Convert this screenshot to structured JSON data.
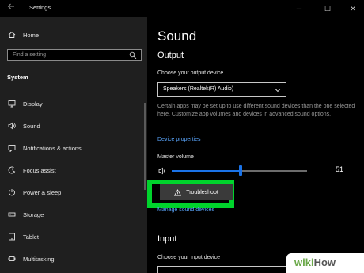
{
  "window": {
    "title": "Settings",
    "controls": {
      "minimize": "─",
      "maximize": "☐",
      "close": "✕"
    }
  },
  "sidebar": {
    "home": "Home",
    "search_placeholder": "Find a setting",
    "section": "System",
    "items": [
      {
        "label": "Display",
        "icon": "display-icon"
      },
      {
        "label": "Sound",
        "icon": "speaker-icon",
        "active": true
      },
      {
        "label": "Notifications & actions",
        "icon": "notifications-icon"
      },
      {
        "label": "Focus assist",
        "icon": "moon-icon"
      },
      {
        "label": "Power & sleep",
        "icon": "power-icon"
      },
      {
        "label": "Storage",
        "icon": "storage-icon"
      },
      {
        "label": "Tablet",
        "icon": "tablet-icon"
      },
      {
        "label": "Multitasking",
        "icon": "multitasking-icon"
      }
    ]
  },
  "main": {
    "title": "Sound",
    "output": {
      "heading": "Output",
      "device_label": "Choose your output device",
      "device_value": "Speakers (Realtek(R) Audio)",
      "description": "Certain apps may be set up to use different sound devices than the one selected here. Customize app volumes and devices in advanced sound options.",
      "device_properties_link": "Device properties",
      "master_volume_label": "Master volume",
      "volume_value": "51",
      "volume_fraction": 0.51,
      "troubleshoot_label": "Troubleshoot",
      "manage_link": "Manage sound devices"
    },
    "input": {
      "heading": "Input",
      "device_label": "Choose your input device"
    }
  },
  "watermark": {
    "part1": "wiki",
    "part2": "How"
  },
  "colors": {
    "accent": "#1a73e8",
    "highlight": "#00d32c",
    "sidebar_bg": "#1f1f1f",
    "link": "#5ba7ff"
  }
}
